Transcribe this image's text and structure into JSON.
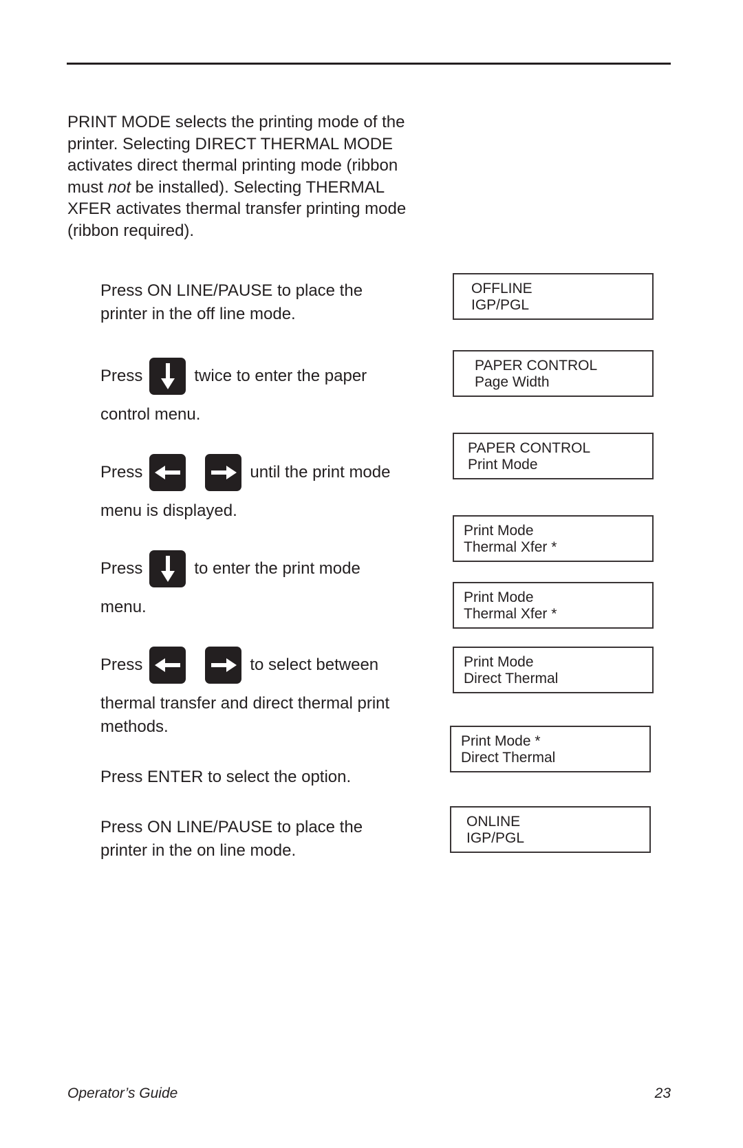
{
  "intro": {
    "part1": "PRINT MODE selects the printing mode of the printer. Selecting DIRECT THERMAL MODE activates direct thermal printing mode (ribbon must ",
    "emphasis": "not",
    "part2": " be installed). Selecting THERMAL XFER activates thermal transfer printing mode (ribbon required)."
  },
  "steps": [
    {
      "text": "Press ON LINE/PAUSE to place the printer in the off line mode."
    },
    {
      "prefix": "Press",
      "key": "down-arrow",
      "suffix": "twice to enter the paper",
      "continuation": "control menu."
    },
    {
      "prefix": "Press",
      "keys": [
        "left-arrow",
        "right-arrow"
      ],
      "suffix": "until the print mode",
      "continuation": "menu is displayed."
    },
    {
      "prefix": "Press",
      "key": "down-arrow",
      "suffix": "to enter the print mode",
      "continuation": "menu."
    },
    {
      "prefix": "Press",
      "keys": [
        "left-arrow",
        "right-arrow"
      ],
      "suffix": "to select between",
      "continuation": "thermal transfer and direct thermal print methods."
    },
    {
      "text": "Press ENTER to select the option."
    },
    {
      "text": "Press ON LINE/PAUSE to place the printer in the on line mode."
    }
  ],
  "displays": [
    {
      "line1": "OFFLINE",
      "line2": "IGP/PGL"
    },
    {
      "line1": "PAPER CONTROL",
      "line2": "Page Width"
    },
    {
      "line1": "PAPER CONTROL",
      "line2": "Print Mode"
    },
    {
      "line1": "Print Mode",
      "line2": "Thermal Xfer *"
    },
    {
      "line1": "Print Mode",
      "line2": "Thermal Xfer *"
    },
    {
      "line1": "Print Mode",
      "line2": "Direct Thermal"
    },
    {
      "line1": "Print Mode *",
      "line2": "Direct Thermal"
    },
    {
      "line1": "ONLINE",
      "line2": "IGP/PGL"
    }
  ],
  "footer": {
    "title": "Operator’s Guide",
    "page_number": "23"
  }
}
